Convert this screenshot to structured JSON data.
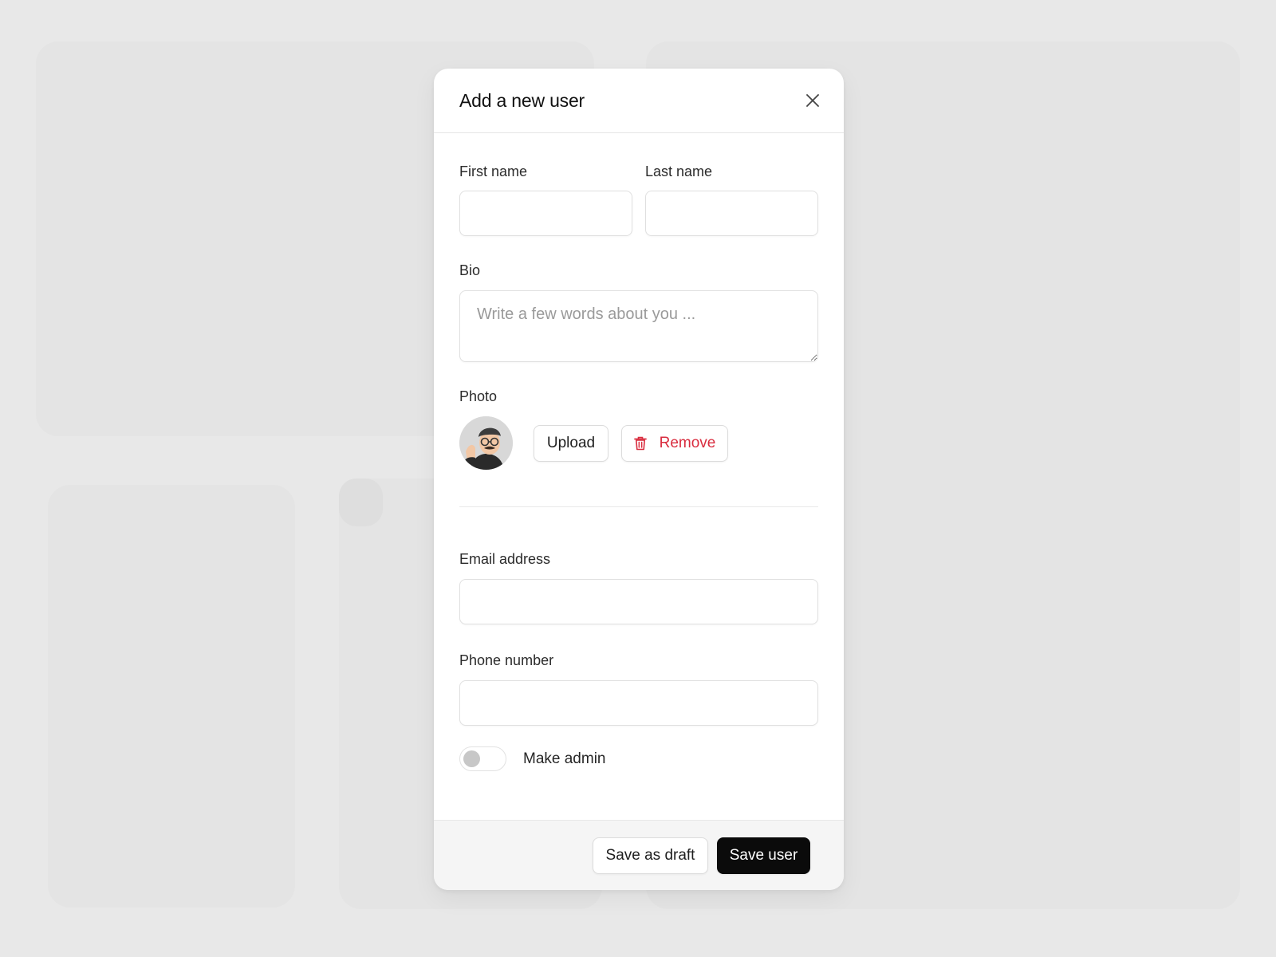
{
  "modal": {
    "title": "Add a new user",
    "close_icon": "close-icon"
  },
  "form": {
    "first_name": {
      "label": "First name",
      "value": ""
    },
    "last_name": {
      "label": "Last name",
      "value": ""
    },
    "bio": {
      "label": "Bio",
      "placeholder": "Write a few words about you ...",
      "value": ""
    },
    "photo": {
      "label": "Photo",
      "upload_label": "Upload",
      "remove_label": "Remove",
      "remove_icon": "trash-icon"
    },
    "email": {
      "label": "Email address",
      "value": ""
    },
    "phone": {
      "label": "Phone number",
      "value": ""
    },
    "admin_toggle": {
      "label": "Make admin",
      "checked": false
    }
  },
  "footer": {
    "draft_label": "Save as draft",
    "save_label": "Save user"
  },
  "colors": {
    "danger": "#d92d3f",
    "primary_button": "#0b0b0b",
    "background": "#e8e8e8"
  }
}
